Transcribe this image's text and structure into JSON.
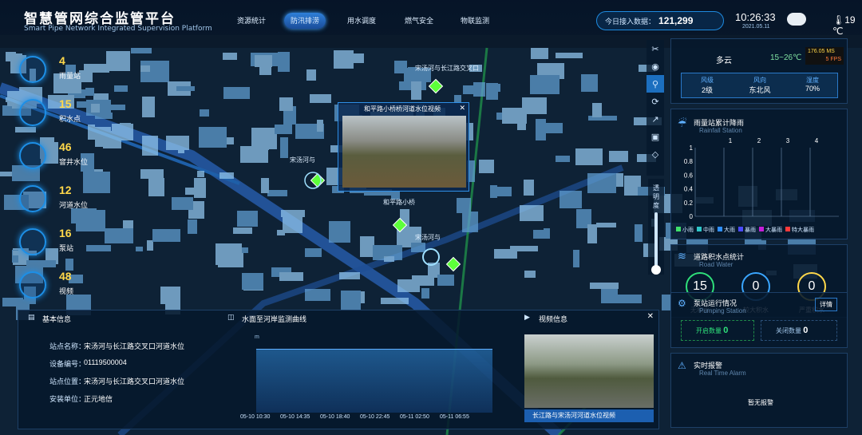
{
  "header": {
    "title": "智慧管网综合监管平台",
    "subtitle": "Smart Pipe Network Integrated Supervision Platform",
    "tabs": [
      {
        "label": "资源统计"
      },
      {
        "label": "防汛排涝"
      },
      {
        "label": "用水调度"
      },
      {
        "label": "燃气安全"
      },
      {
        "label": "物联监测"
      }
    ],
    "access_label": "今日接入数据：",
    "access_value": "121,299",
    "time": "10:26:33",
    "date": "2021.05.11",
    "temperature": "19 ℃"
  },
  "left_stats": [
    {
      "value": "4",
      "label": "雨量站"
    },
    {
      "value": "15",
      "label": "积水点"
    },
    {
      "value": "46",
      "label": "窨井水位"
    },
    {
      "value": "12",
      "label": "河道水位"
    },
    {
      "value": "16",
      "label": "泵站"
    },
    {
      "value": "48",
      "label": "视频"
    }
  ],
  "map_labels": [
    "宋汤河与长江路交叉口",
    "和平路小桥桥河道水位",
    "宋汤河与",
    "和平路小桥",
    "宋汤河与",
    "宋汤河与",
    "长江路"
  ],
  "map_popup": {
    "title": "和平路小桥桥河道水位视频",
    "caption": "和平路小桥桥河道水位视频"
  },
  "tools": {
    "opacity_label": "透明度"
  },
  "weather": {
    "condition": "多云",
    "temp_range": "15~26℃",
    "speed": "176.05 MS",
    "fps": "5 FPS",
    "items": [
      {
        "label": "风级",
        "value": "2级"
      },
      {
        "label": "风向",
        "value": "东北风"
      },
      {
        "label": "湿度",
        "value": "70%"
      }
    ]
  },
  "rain": {
    "title": "雨量站累计降雨",
    "sub": "Rainfall Station",
    "x_ticks": [
      "1",
      "2",
      "3",
      "4"
    ],
    "y_ticks": [
      "1",
      "0.8",
      "0.6",
      "0.4",
      "0.2",
      "0"
    ],
    "legend": [
      {
        "label": "小雨",
        "color": "#3fe06b"
      },
      {
        "label": "中雨",
        "color": "#2ec7c9"
      },
      {
        "label": "大雨",
        "color": "#2f8fff"
      },
      {
        "label": "暴雨",
        "color": "#4a4aff"
      },
      {
        "label": "大暴雨",
        "color": "#c41fd8"
      },
      {
        "label": "特大暴雨",
        "color": "#ff3a3a"
      }
    ]
  },
  "road_water": {
    "title": "道路积水点统计",
    "sub": "Road Water",
    "items": [
      {
        "value": "15",
        "label": "无积水",
        "color": "#2fe07a"
      },
      {
        "value": "0",
        "label": "较大积水",
        "color": "#3aa6ff"
      },
      {
        "value": "0",
        "label": "严重积水",
        "color": "#ffd84a"
      }
    ]
  },
  "pump": {
    "title": "泵站运行情况",
    "sub": "Pumping Station",
    "detail": "详情",
    "open_label": "开启数量",
    "open_value": "0",
    "closed_label": "关闭数量",
    "closed_value": "0"
  },
  "alarm": {
    "title": "实时报警",
    "sub": "Real Time Alarm",
    "empty": "暂无报警"
  },
  "basic_info": {
    "title": "基本信息",
    "rows": [
      {
        "k": "站点名称：",
        "v": "宋汤河与长江路交叉口河道水位"
      },
      {
        "k": "设备编号：",
        "v": "01119500004"
      },
      {
        "k": "站点位置：",
        "v": "宋汤河与长江路交叉口河道水位"
      },
      {
        "k": "安装单位：",
        "v": "正元地信"
      }
    ]
  },
  "curve": {
    "title": "水面至河岸监测曲线",
    "unit": "m",
    "x_ticks": [
      "05-10 10:30",
      "05-10 14:35",
      "05-10 18:40",
      "05-10 22:45",
      "05-11 02:50",
      "05-11 06:55"
    ]
  },
  "video": {
    "title": "视频信息",
    "caption": "长江路与宋汤河河道水位视频"
  },
  "chart_data": [
    {
      "type": "bar",
      "title": "雨量站累计降雨",
      "categories": [
        "1",
        "2",
        "3",
        "4"
      ],
      "ylim": [
        0,
        1
      ],
      "series": []
    },
    {
      "type": "area",
      "title": "水面至河岸监测曲线",
      "ylabel": "m",
      "x": [
        "05-10 10:30",
        "05-10 14:35",
        "05-10 18:40",
        "05-10 22:45",
        "05-11 02:50",
        "05-11 06:55"
      ]
    }
  ]
}
